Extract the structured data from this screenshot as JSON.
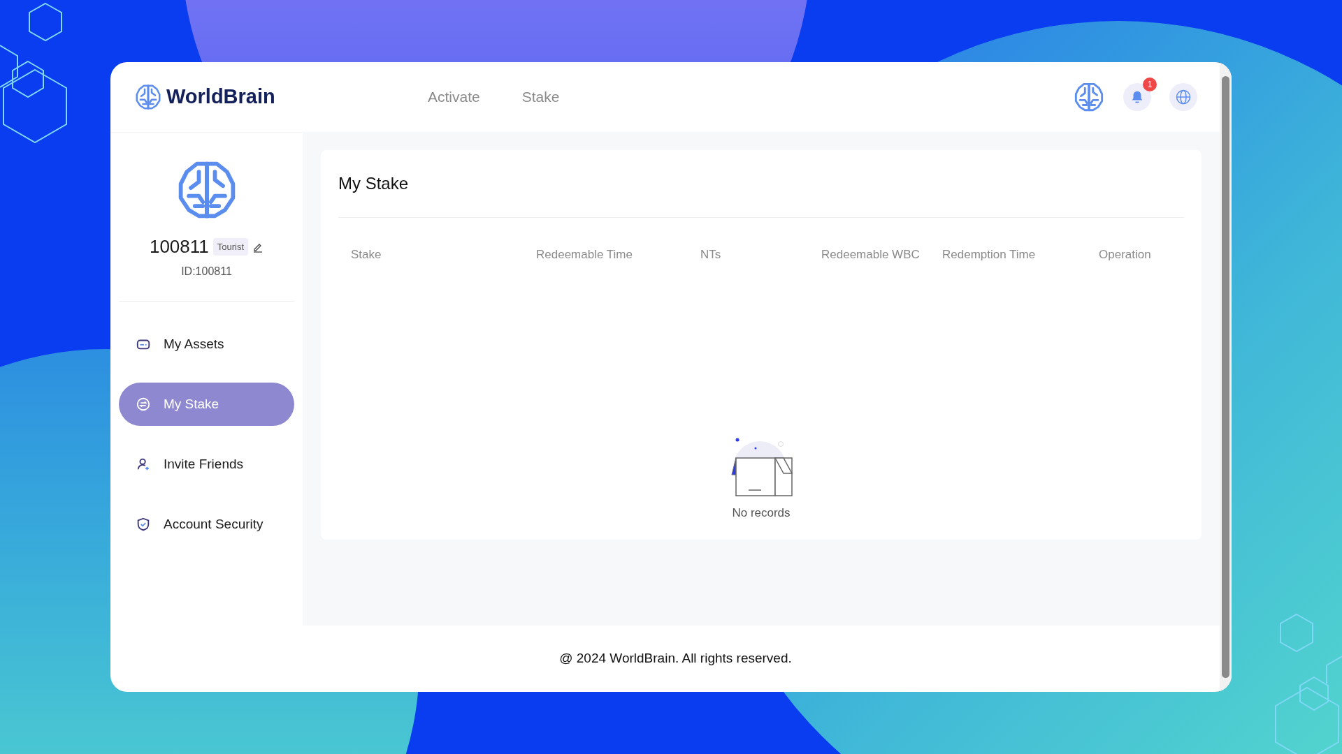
{
  "header": {
    "logo": "WorldBrain",
    "nav": [
      {
        "label": "Activate",
        "selected": false
      },
      {
        "label": "Stake",
        "selected": false
      }
    ],
    "notification_badge": "1"
  },
  "profile": {
    "name": "100811",
    "role": "Tourist",
    "id": "ID:100811"
  },
  "sidebar": {
    "items": [
      {
        "label": "My Assets",
        "kind": "card",
        "selected": false
      },
      {
        "label": "My Stake",
        "kind": "exchange",
        "selected": true
      },
      {
        "label": "Invite Friends",
        "kind": "user",
        "selected": false
      },
      {
        "label": "Account Security",
        "kind": "shield",
        "selected": false
      }
    ]
  },
  "panel": {
    "title": "My Stake",
    "table": {
      "columns": [
        "Stake",
        "Redeemable Time",
        "NTs",
        "Redeemable WBC",
        "Redemption Time",
        "Operation"
      ]
    },
    "empty_text": "No records"
  },
  "footer": "@ 2024 WorldBrain. All rights reserved."
}
